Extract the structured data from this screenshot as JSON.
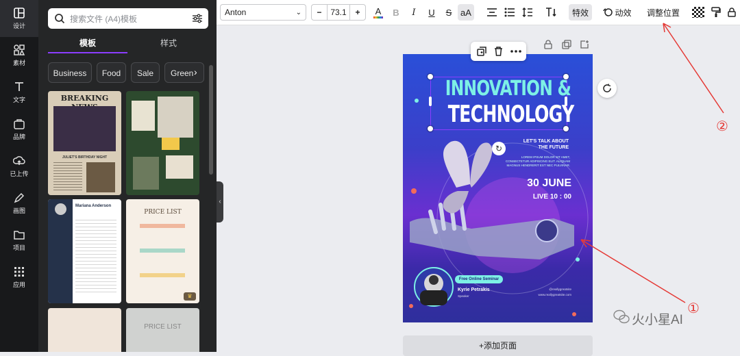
{
  "rail": {
    "items": [
      {
        "label": "设计",
        "icon": "layout-icon"
      },
      {
        "label": "素材",
        "icon": "shapes-icon"
      },
      {
        "label": "文字",
        "icon": "text-icon"
      },
      {
        "label": "品牌",
        "icon": "brand-icon"
      },
      {
        "label": "已上传",
        "icon": "upload-cloud-icon"
      },
      {
        "label": "画图",
        "icon": "draw-icon"
      },
      {
        "label": "项目",
        "icon": "folder-icon"
      },
      {
        "label": "应用",
        "icon": "apps-icon"
      }
    ]
  },
  "panel": {
    "search_placeholder": "搜索文件 (A4)模板",
    "tabs": [
      "模板",
      "样式"
    ],
    "chips": [
      "Business",
      "Food",
      "Sale",
      "Green"
    ],
    "templates": {
      "news_title": "BREAKING NEWS",
      "news_caption": "JULIET'S BIRTHDAY NIGHT",
      "resume_name": "Mariana Anderson",
      "price_title": "PRICE LIST",
      "price_title_2": "PRICE LIST"
    }
  },
  "toolbar": {
    "font": "Anton",
    "font_size": "73.1",
    "minus": "−",
    "plus": "+",
    "bold": "B",
    "italic": "I",
    "underline": "U",
    "strike": "S",
    "case": "aA",
    "effects": "特效",
    "animate": "动效",
    "position": "调整位置"
  },
  "design": {
    "headline1": "INNOVATION &",
    "headline2": "TECHNOLOGY",
    "talk": "LET'S TALK ABOUT",
    "future": "THE FUTURE",
    "lorem": "LOREM IPSUM DOLOR SIT AMET, CONSECTETUR ADIPISCING ELIT. ALIQUAM MAGNUS HENDRERIT EST NEC PULVINAR.",
    "date": "30 JUNE",
    "time": "LIVE 10 : 00",
    "seminar": "Free Online Seminar",
    "speaker": "Kyrie Petrakis",
    "speaker_role": "Speaker",
    "handle": "@reallygreatsite",
    "site": "www.reallygreatsite.com"
  },
  "add_page": "+添加页面",
  "annotations": {
    "one": "①",
    "two": "②"
  },
  "watermark": "火小星AI",
  "colors": {
    "accent": "#8b3dff",
    "headline": "#7df0e6",
    "annotation": "#e53935"
  }
}
